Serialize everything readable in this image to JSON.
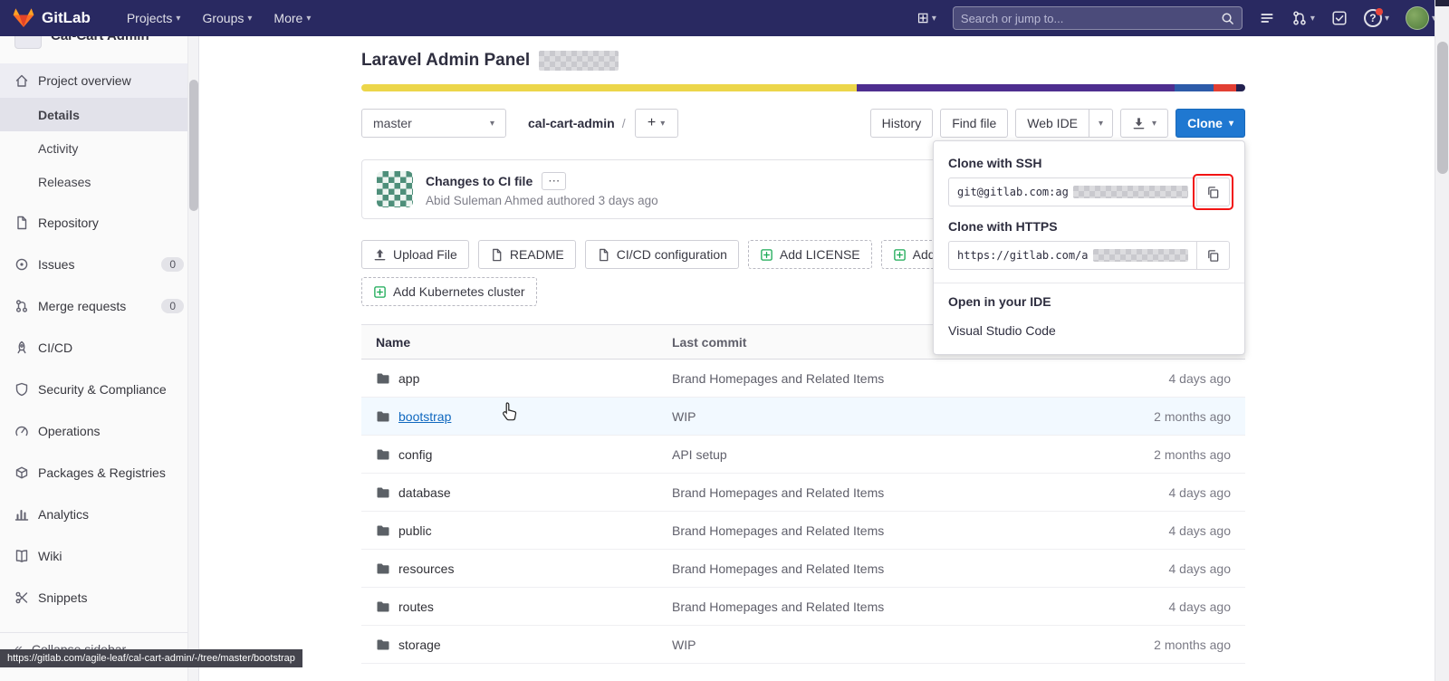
{
  "icons": {
    "caret": "▾",
    "plus": "+",
    "grid_plus": "⊞",
    "ellipsis": "⋯",
    "question": "?",
    "collapse": "«"
  },
  "navbar": {
    "brand": "GitLab",
    "menus": [
      "Projects",
      "Groups",
      "More"
    ],
    "search_placeholder": "Search or jump to..."
  },
  "sidebar": {
    "project_name": "Cal-Cart Admin",
    "items": [
      {
        "label": "Project overview",
        "icon": "home",
        "active": true
      },
      {
        "label": "Details",
        "indent": true,
        "current": true
      },
      {
        "label": "Activity",
        "indent": true
      },
      {
        "label": "Releases",
        "indent": true
      },
      {
        "label": "Repository",
        "icon": "doc",
        "top": true
      },
      {
        "label": "Issues",
        "icon": "issues",
        "badge": "0",
        "top": true
      },
      {
        "label": "Merge requests",
        "icon": "merge",
        "badge": "0",
        "top": true
      },
      {
        "label": "CI/CD",
        "icon": "rocket",
        "top": true
      },
      {
        "label": "Security & Compliance",
        "icon": "shield",
        "top": true
      },
      {
        "label": "Operations",
        "icon": "operations",
        "top": true
      },
      {
        "label": "Packages & Registries",
        "icon": "package",
        "top": true
      },
      {
        "label": "Analytics",
        "icon": "chart",
        "top": true
      },
      {
        "label": "Wiki",
        "icon": "book",
        "top": true
      },
      {
        "label": "Snippets",
        "icon": "snippets",
        "top": true
      }
    ],
    "collapse_label": "Collapse sidebar"
  },
  "project": {
    "title": "Laravel Admin Panel",
    "languages": [
      {
        "color": "#ecd64a",
        "pct": 56
      },
      {
        "color": "#4e2e8f",
        "pct": 36
      },
      {
        "color": "#2d5ba9",
        "pct": 4.4
      },
      {
        "color": "#e23f33",
        "pct": 2.6
      },
      {
        "color": "#232150",
        "pct": 1
      }
    ]
  },
  "toolbar": {
    "branch": "master",
    "breadcrumb": "cal-cart-admin",
    "breadcrumb_sep": "/",
    "history": "History",
    "find_file": "Find file",
    "web_ide": "Web IDE",
    "clone": "Clone"
  },
  "clone_panel": {
    "ssh_label": "Clone with SSH",
    "ssh_value": "git@gitlab.com:ag",
    "https_label": "Clone with HTTPS",
    "https_value": "https://gitlab.com/a",
    "ide_label": "Open in your IDE",
    "ide_option": "Visual Studio Code"
  },
  "commit": {
    "title": "Changes to CI file",
    "byline": "Abid Suleman Ahmed authored 3 days ago"
  },
  "actions_row1": [
    {
      "label": "Upload File",
      "icon": "upload"
    },
    {
      "label": "README",
      "icon": "doc"
    },
    {
      "label": "CI/CD configuration",
      "icon": "doc"
    },
    {
      "label": "Add LICENSE",
      "icon": "plus-square",
      "dashed": true
    },
    {
      "label": "Add CHANGELOG",
      "icon": "plus-square",
      "dashed": true
    }
  ],
  "actions_row2": [
    {
      "label": "Add Kubernetes cluster",
      "icon": "plus-square",
      "dashed": true
    }
  ],
  "table": {
    "col_name": "Name",
    "col_commit": "Last commit",
    "rows": [
      {
        "name": "app",
        "commit": "Brand Homepages and Related Items",
        "updated": "4 days ago"
      },
      {
        "name": "bootstrap",
        "commit": "WIP",
        "updated": "2 months ago",
        "highlight": true
      },
      {
        "name": "config",
        "commit": "API setup",
        "updated": "2 months ago"
      },
      {
        "name": "database",
        "commit": "Brand Homepages and Related Items",
        "updated": "4 days ago"
      },
      {
        "name": "public",
        "commit": "Brand Homepages and Related Items",
        "updated": "4 days ago"
      },
      {
        "name": "resources",
        "commit": "Brand Homepages and Related Items",
        "updated": "4 days ago"
      },
      {
        "name": "routes",
        "commit": "Brand Homepages and Related Items",
        "updated": "4 days ago"
      },
      {
        "name": "storage",
        "commit": "WIP",
        "updated": "2 months ago"
      }
    ]
  },
  "statusbar": {
    "url": "https://gitlab.com/agile-leaf/cal-cart-admin/-/tree/master/bootstrap"
  }
}
